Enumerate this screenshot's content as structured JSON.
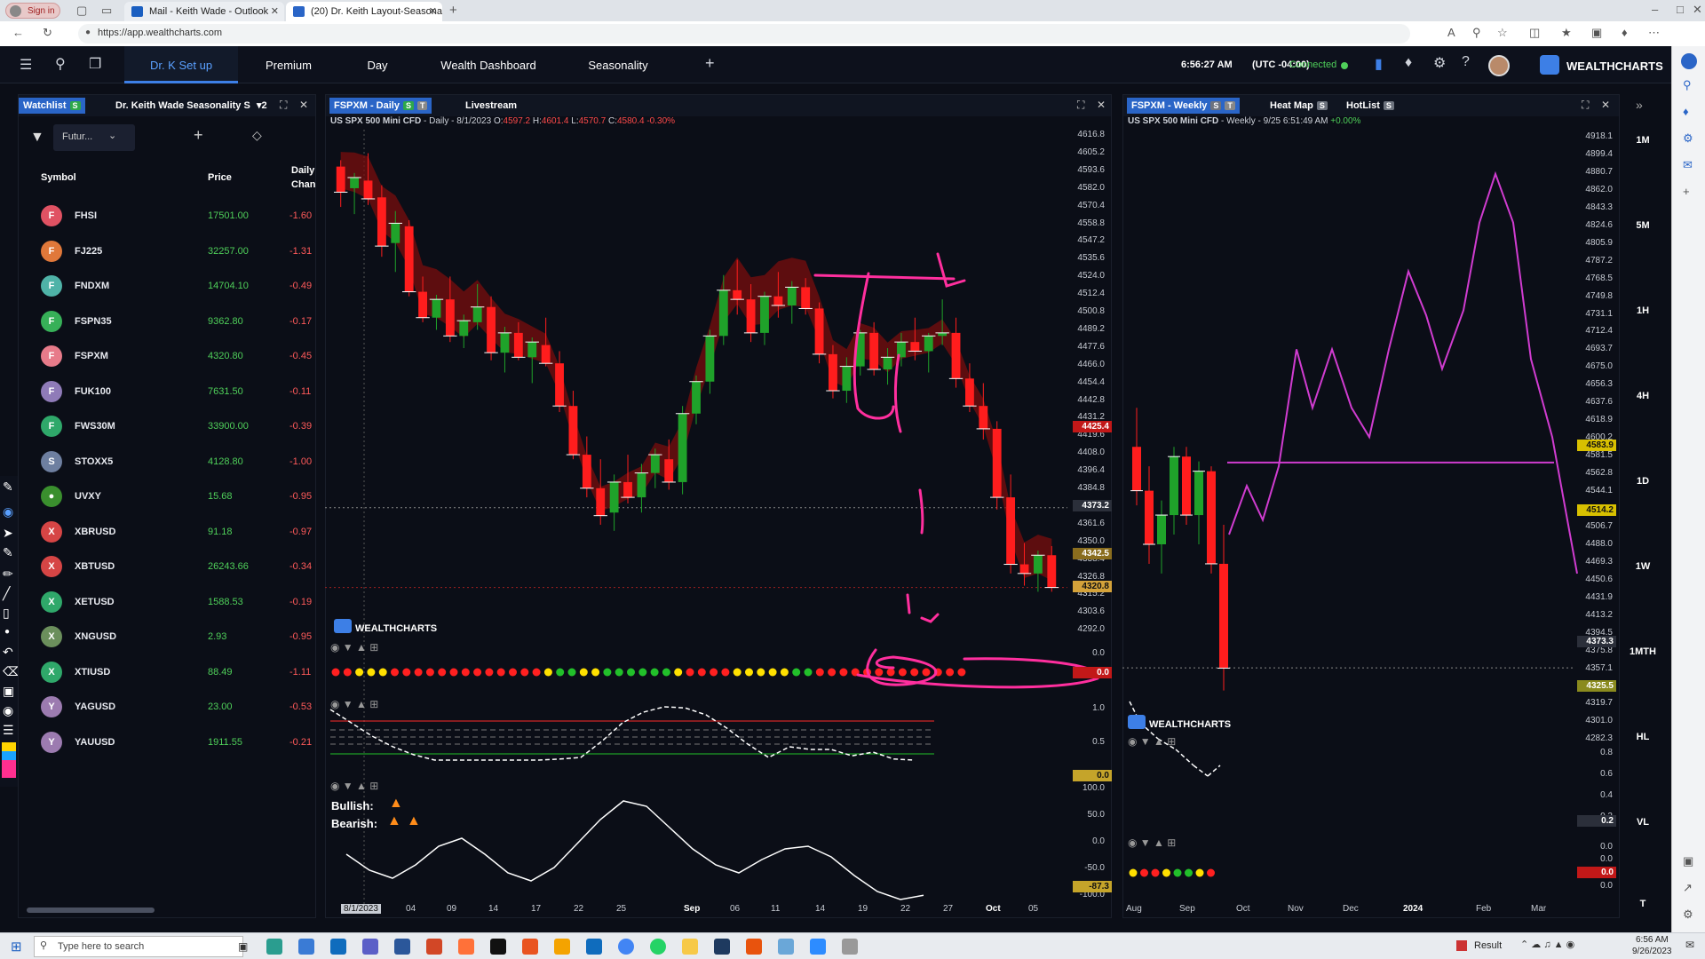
{
  "browser": {
    "signin_label": "Sign in",
    "tabs": [
      {
        "title": "Mail - Keith Wade - Outlook"
      },
      {
        "title": "(20) Dr. Keith Layout-Seasonal - ·"
      }
    ],
    "url": "https://app.wealthcharts.com"
  },
  "app": {
    "nav_tabs": [
      "Dr. K Set up",
      "Premium",
      "Day",
      "Wealth Dashboard",
      "Seasonality"
    ],
    "add_tab": "+",
    "time": "6:56:27 AM",
    "timezone": "(UTC -04:00)",
    "connection": "Connected",
    "brand": "WEALTHCHARTS",
    "accent_color": "#3d7fe6"
  },
  "watchlist": {
    "tab1": "Watchlist",
    "tab1_badge": "S",
    "tab2": "Dr. Keith Wade Seasonality S",
    "tab2_count": "2",
    "filter_label": "Futur...",
    "add_label": "+",
    "col_symbol": "Symbol",
    "col_price": "Price",
    "col_change_line1": "Daily",
    "col_change_line2": "Chan",
    "rows": [
      {
        "icon": "F",
        "color": "#e05263",
        "symbol": "FHSI",
        "price": "17501.00",
        "change": "-1.60"
      },
      {
        "icon": "F",
        "color": "#e0783a",
        "symbol": "FJ225",
        "price": "32257.00",
        "change": "-1.31"
      },
      {
        "icon": "F",
        "color": "#4fb3a8",
        "symbol": "FNDXM",
        "price": "14704.10",
        "change": "-0.49"
      },
      {
        "icon": "F",
        "color": "#37b058",
        "symbol": "FSPN35",
        "price": "9362.80",
        "change": "-0.17"
      },
      {
        "icon": "F",
        "color": "#e77b8a",
        "symbol": "FSPXM",
        "price": "4320.80",
        "change": "-0.45"
      },
      {
        "icon": "F",
        "color": "#8f7bb8",
        "symbol": "FUK100",
        "price": "7631.50",
        "change": "-0.11"
      },
      {
        "icon": "F",
        "color": "#2fa86a",
        "symbol": "FWS30M",
        "price": "33900.00",
        "change": "-0.39"
      },
      {
        "icon": "S",
        "color": "#6e7fa0",
        "symbol": "STOXX5",
        "price": "4128.80",
        "change": "-1.00"
      },
      {
        "icon": "●",
        "color": "#3a8f2e",
        "symbol": "UVXY",
        "price": "15.68",
        "change": "-0.95"
      },
      {
        "icon": "X",
        "color": "#d64545",
        "symbol": "XBRUSD",
        "price": "91.18",
        "change": "-0.97"
      },
      {
        "icon": "X",
        "color": "#d64545",
        "symbol": "XBTUSD",
        "price": "26243.66",
        "change": "-0.34"
      },
      {
        "icon": "X",
        "color": "#2fa86a",
        "symbol": "XETUSD",
        "price": "1588.53",
        "change": "-0.19"
      },
      {
        "icon": "X",
        "color": "#6b8f5c",
        "symbol": "XNGUSD",
        "price": "2.93",
        "change": "-0.95"
      },
      {
        "icon": "X",
        "color": "#2fa86a",
        "symbol": "XTIUSD",
        "price": "88.49",
        "change": "-1.11"
      },
      {
        "icon": "Y",
        "color": "#9c7bb0",
        "symbol": "YAGUSD",
        "price": "23.00",
        "change": "-0.53"
      },
      {
        "icon": "Y",
        "color": "#9c7bb0",
        "symbol": "YAUUSD",
        "price": "1911.55",
        "change": "-0.21"
      }
    ]
  },
  "daily_chart": {
    "tab": "FSPXM - Daily",
    "tab_badge1": "S",
    "tab_badge2": "T",
    "tab2": "Livestream",
    "info": "US SPX 500 Mini CFD",
    "info_period": " - Daily - 8/1/2023 O:",
    "open": "4597.2",
    "h_label": " H:",
    "high": "4601.4",
    "l_label": " L:",
    "low": "4570.7",
    "c_label": " C:",
    "close": "4580.4",
    "pct": " -0.30%",
    "brand": "WEALTHCHARTS",
    "price_labels": [
      "4616.8",
      "4605.2",
      "4593.6",
      "4582.0",
      "4570.4",
      "4558.8",
      "4547.2",
      "4535.6",
      "4524.0",
      "4512.4",
      "4500.8",
      "4489.2",
      "4477.6",
      "4466.0",
      "4454.4",
      "4442.8",
      "4431.2",
      "4419.6",
      "4408.0",
      "4396.4",
      "4384.8",
      "4373.2",
      "4361.6",
      "4350.0",
      "4338.4",
      "4326.8",
      "4315.2",
      "4303.6",
      "4292.0"
    ],
    "tag_red": "4425.4",
    "tag_cross": "4373.2",
    "tag_gold": "4342.5",
    "tag_last": "4320.8",
    "ind1_axis": "0.0",
    "ind1_tag": "0.0",
    "ind2_axis": [
      "1.0",
      "0.5",
      "0.0"
    ],
    "ind2_tag": "0.0",
    "ind3_axis": [
      "100.0",
      "50.0",
      "0.0",
      "-50.0",
      "-100.0"
    ],
    "ind3_tag": "-87.3",
    "bullish_label": "Bullish:",
    "bearish_label": "Bearish:",
    "x_labels": [
      "8/1/2023",
      "04",
      "09",
      "14",
      "17",
      "22",
      "25",
      "Sep",
      "06",
      "11",
      "14",
      "19",
      "22",
      "27",
      "Oct",
      "05"
    ],
    "dots": [
      "r",
      "r",
      "y",
      "y",
      "y",
      "r",
      "r",
      "r",
      "r",
      "r",
      "r",
      "r",
      "r",
      "r",
      "r",
      "r",
      "r",
      "r",
      "y",
      "g",
      "g",
      "y",
      "y",
      "g",
      "g",
      "g",
      "g",
      "g",
      "g",
      "y",
      "r",
      "r",
      "r",
      "r",
      "y",
      "y",
      "y",
      "y",
      "y",
      "g",
      "g",
      "r",
      "r",
      "r",
      "r",
      "r",
      "r",
      "r",
      "r",
      "r",
      "r",
      "r",
      "r",
      "r"
    ],
    "candles": [
      [
        4597.2,
        4601.4,
        4570.7,
        4580.4
      ],
      [
        4583,
        4593,
        4566,
        4590
      ],
      [
        4588,
        4606,
        4572,
        4576
      ],
      [
        4577,
        4585,
        4538,
        4545
      ],
      [
        4547,
        4568,
        4528,
        4560
      ],
      [
        4558,
        4562,
        4512,
        4515
      ],
      [
        4515,
        4525,
        4495,
        4498
      ],
      [
        4498,
        4513,
        4490,
        4510
      ],
      [
        4510,
        4525,
        4482,
        4486
      ],
      [
        4486,
        4500,
        4478,
        4496
      ],
      [
        4495,
        4520,
        4490,
        4505
      ],
      [
        4505,
        4512,
        4470,
        4475
      ],
      [
        4475,
        4492,
        4462,
        4488
      ],
      [
        4488,
        4495,
        4470,
        4472
      ],
      [
        4472,
        4485,
        4455,
        4482
      ],
      [
        4480,
        4498,
        4466,
        4468
      ],
      [
        4468,
        4476,
        4436,
        4440
      ],
      [
        4440,
        4450,
        4405,
        4408
      ],
      [
        4408,
        4420,
        4380,
        4386
      ],
      [
        4386,
        4405,
        4362,
        4368
      ],
      [
        4370,
        4395,
        4358,
        4390
      ],
      [
        4390,
        4408,
        4376,
        4380
      ],
      [
        4380,
        4402,
        4370,
        4396
      ],
      [
        4396,
        4412,
        4386,
        4408
      ],
      [
        4405,
        4418,
        4385,
        4390
      ],
      [
        4390,
        4440,
        4382,
        4435
      ],
      [
        4435,
        4460,
        4428,
        4456
      ],
      [
        4456,
        4490,
        4448,
        4486
      ],
      [
        4486,
        4526,
        4480,
        4516
      ],
      [
        4516,
        4536,
        4500,
        4510
      ],
      [
        4510,
        4520,
        4482,
        4488
      ],
      [
        4488,
        4515,
        4480,
        4512
      ],
      [
        4512,
        4528,
        4498,
        4506
      ],
      [
        4506,
        4522,
        4494,
        4518
      ],
      [
        4518,
        4524,
        4500,
        4504
      ],
      [
        4504,
        4508,
        4468,
        4474
      ],
      [
        4474,
        4480,
        4445,
        4450
      ],
      [
        4450,
        4472,
        4442,
        4466
      ],
      [
        4466,
        4490,
        4460,
        4488
      ],
      [
        4488,
        4495,
        4460,
        4464
      ],
      [
        4464,
        4478,
        4454,
        4472
      ],
      [
        4472,
        4488,
        4466,
        4482
      ],
      [
        4482,
        4498,
        4470,
        4476
      ],
      [
        4476,
        4488,
        4462,
        4486
      ],
      [
        4486,
        4510,
        4480,
        4488
      ],
      [
        4488,
        4498,
        4452,
        4458
      ],
      [
        4458,
        4468,
        4436,
        4440
      ],
      [
        4440,
        4455,
        4418,
        4425
      ],
      [
        4425,
        4430,
        4372,
        4380
      ],
      [
        4380,
        4395,
        4330,
        4336
      ],
      [
        4336,
        4350,
        4322,
        4330
      ],
      [
        4330,
        4345,
        4318,
        4342
      ],
      [
        4342,
        4348,
        4318,
        4320.8
      ]
    ]
  },
  "weekly_chart": {
    "tab": "FSPXM - Weekly",
    "tab_badge1": "S",
    "tab_badge2": "T",
    "tab2": "Heat Map",
    "tab2_badge": "S",
    "tab3": "HotList",
    "tab3_badge": "S",
    "info": "US SPX 500 Mini CFD",
    "info_period": " - Weekly - 9/25 6:51:49 AM",
    "pct": " +0.00%",
    "brand": "WEALTHCHARTS",
    "price_labels": [
      "4918.1",
      "4899.4",
      "4880.7",
      "4862.0",
      "4843.3",
      "4824.6",
      "4805.9",
      "4787.2",
      "4768.5",
      "4749.8",
      "4731.1",
      "4712.4",
      "4693.7",
      "4675.0",
      "4656.3",
      "4637.6",
      "4618.9",
      "4600.2",
      "4581.5",
      "4562.8",
      "4544.1",
      "4525.4",
      "4506.7",
      "4488.0",
      "4469.3",
      "4450.6",
      "4431.9",
      "4413.2",
      "4394.5",
      "4375.8",
      "4357.1",
      "4338.4",
      "4319.7",
      "4301.0",
      "4282.3"
    ],
    "tag_gold1": "4583.9",
    "tag_gold2": "4514.2",
    "tag_cross": "4373.3",
    "tag_gold3": "4325.5",
    "ind_axis": [
      "0.8",
      "0.6",
      "0.4",
      "0.2",
      "0.0"
    ],
    "ind_tag": "0.2",
    "ind2_axis": [
      "0.0",
      "0.0"
    ],
    "ind2_tag": "0.0",
    "x_labels": [
      "Aug",
      "Sep",
      "Oct",
      "Nov",
      "Dec",
      "2024",
      "Feb",
      "Mar"
    ],
    "dots": [
      "y",
      "r",
      "r",
      "y",
      "g",
      "g",
      "y",
      "r"
    ],
    "timeframes": [
      "1M",
      "5M",
      "1H",
      "4H",
      "1D",
      "1W",
      "1MTH",
      "HL",
      "VL",
      "T"
    ]
  },
  "taskbar": {
    "search_placeholder": "Type here to search",
    "result_label": "Result",
    "clock_time": "6:56 AM",
    "clock_date": "9/26/2023"
  }
}
